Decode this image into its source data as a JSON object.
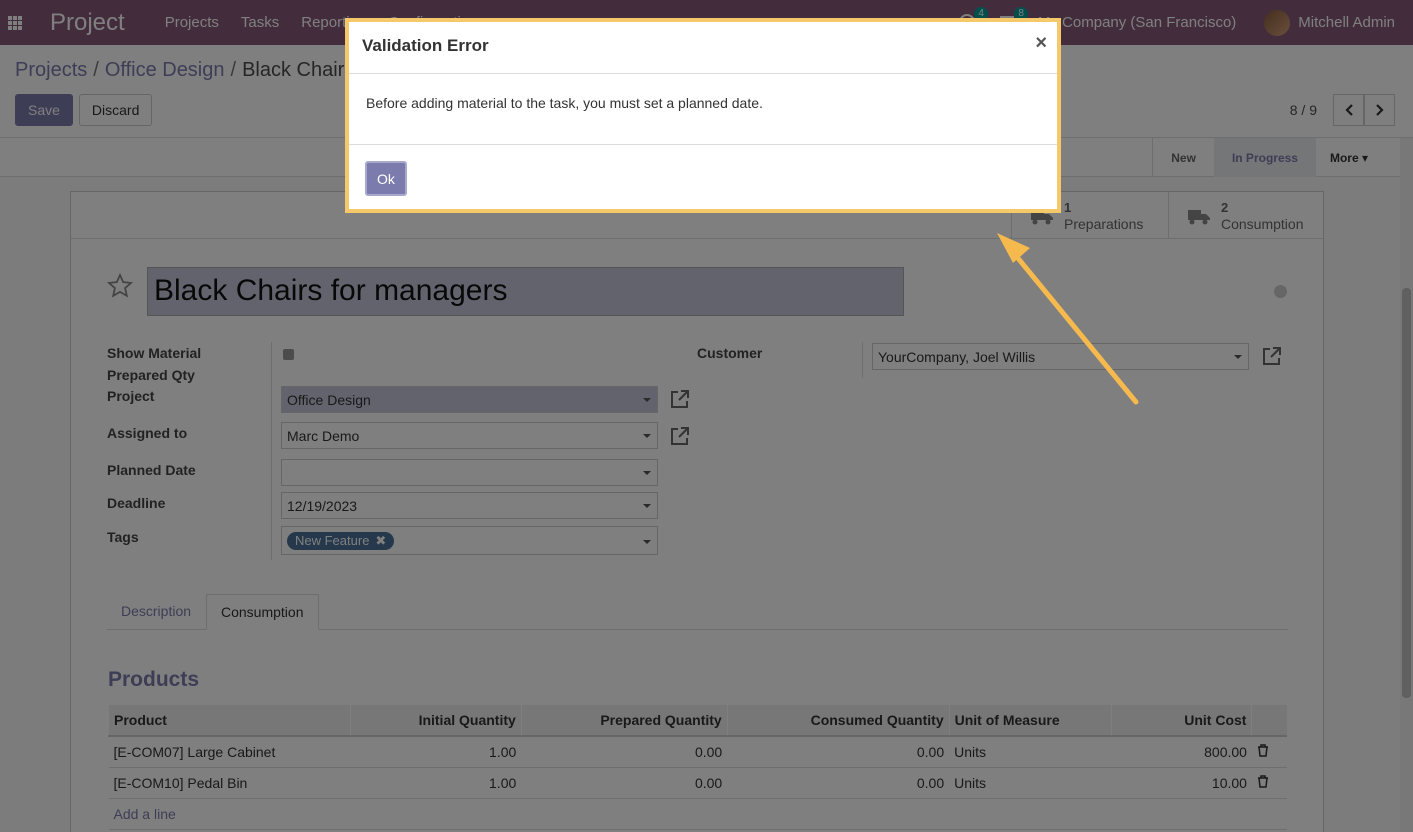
{
  "navbar": {
    "brand": "Project",
    "menu": [
      "Projects",
      "Tasks",
      "Reporting",
      "Configuration"
    ],
    "activity_count": "4",
    "messages_count": "8",
    "company": "My Company (San Francisco)",
    "user": "Mitchell Admin"
  },
  "breadcrumb": {
    "items": [
      "Projects",
      "Office Design",
      "Black Chairs for managers"
    ],
    "separator": "/"
  },
  "actions": {
    "save": "Save",
    "discard": "Discard"
  },
  "pager": {
    "value": "8 / 9"
  },
  "stages": {
    "items": [
      "New",
      "In Progress"
    ],
    "active": "In Progress",
    "more": "More"
  },
  "stat_buttons": [
    {
      "value": "1",
      "label": "Preparations",
      "icon": "truck-icon"
    },
    {
      "value": "2",
      "label": "Consumption",
      "icon": "truck-icon"
    }
  ],
  "task": {
    "title": "Black Chairs for managers",
    "labels": {
      "show_material": "Show Material",
      "prepared_qty": "Prepared Qty",
      "project": "Project",
      "assigned_to": "Assigned to",
      "planned_date": "Planned Date",
      "deadline": "Deadline",
      "tags": "Tags",
      "customer": "Customer"
    },
    "project": "Office Design",
    "assigned_to": "Marc Demo",
    "planned_date": "",
    "deadline": "12/19/2023",
    "tag": "New Feature",
    "customer": "YourCompany, Joel Willis"
  },
  "tabs": [
    "Description",
    "Consumption"
  ],
  "active_tab": "Consumption",
  "products": {
    "title": "Products",
    "columns": [
      "Product",
      "Initial Quantity",
      "Prepared Quantity",
      "Consumed Quantity",
      "Unit of Measure",
      "Unit Cost"
    ],
    "rows": [
      [
        "[E-COM07] Large Cabinet",
        "1.00",
        "0.00",
        "0.00",
        "Units",
        "800.00"
      ],
      [
        "[E-COM10] Pedal Bin",
        "1.00",
        "0.00",
        "0.00",
        "Units",
        "10.00"
      ]
    ],
    "add_line": "Add a line"
  },
  "modal": {
    "title": "Validation Error",
    "close": "×",
    "message": "Before adding material to the task, you must set a planned date.",
    "ok": "Ok"
  },
  "colors": {
    "primary": "#7c7bad",
    "navbar": "#875a7b",
    "highlight_border": "#f5c969",
    "arrow": "#f5b94d"
  }
}
